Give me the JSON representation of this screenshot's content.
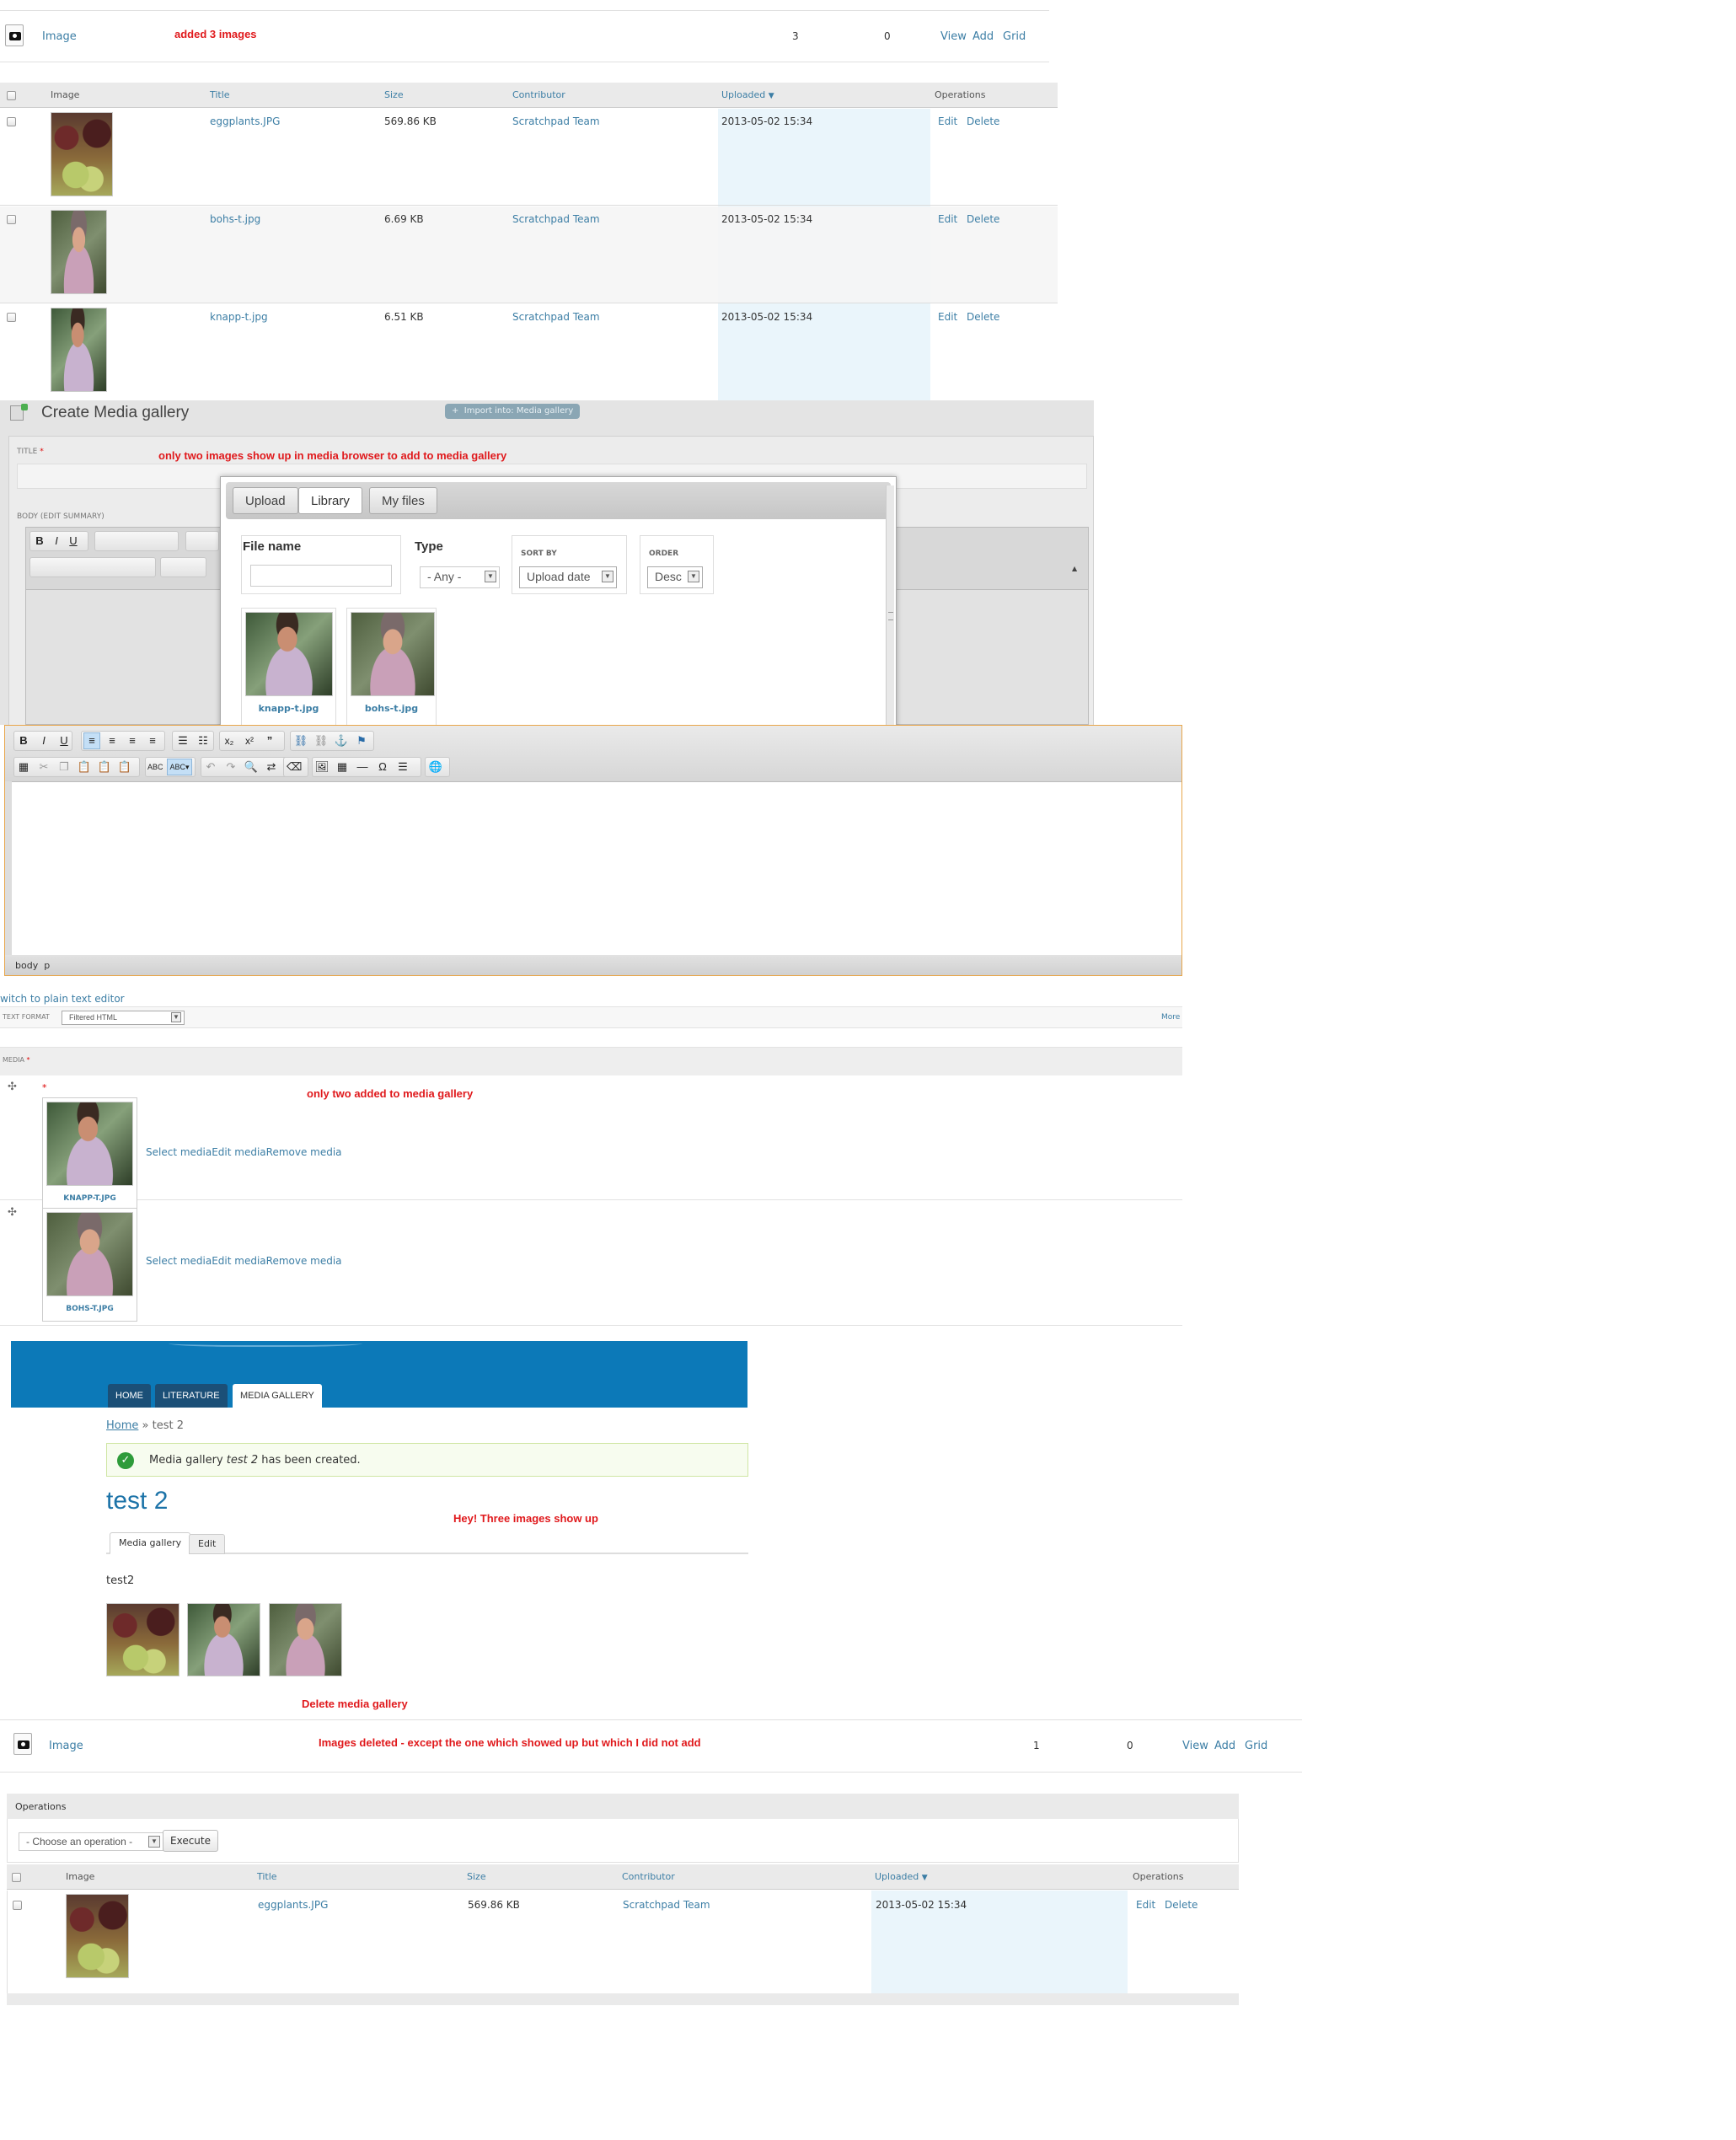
{
  "seg1": {
    "type_label": "Image",
    "annotation": "added 3 images",
    "count": "3",
    "zero": "0",
    "ops": [
      "View",
      "Add",
      "Grid"
    ]
  },
  "table1": {
    "headers": [
      "Image",
      "Title",
      "Size",
      "Contributor",
      "Uploaded",
      "Operations"
    ],
    "rows": [
      {
        "title": "eggplants.JPG",
        "size": "569.86 KB",
        "contributor": "Scratchpad Team",
        "uploaded": "2013-05-02 15:34",
        "edit": "Edit",
        "delete": "Delete"
      },
      {
        "title": "bohs-t.jpg",
        "size": "6.69 KB",
        "contributor": "Scratchpad Team",
        "uploaded": "2013-05-02 15:34",
        "edit": "Edit",
        "delete": "Delete"
      },
      {
        "title": "knapp-t.jpg",
        "size": "6.51 KB",
        "contributor": "Scratchpad Team",
        "uploaded": "2013-05-02 15:34",
        "edit": "Edit",
        "delete": "Delete"
      }
    ]
  },
  "create": {
    "title": "Create Media gallery",
    "import_button": "Import into: Media gallery",
    "title_label": "TITLE",
    "annotation": "only two images show up in media browser to add to media gallery",
    "body_label": "BODY (EDIT SUMMARY)",
    "browser": {
      "tabs": [
        "Upload",
        "Library",
        "My files"
      ],
      "file_name_label": "File name",
      "type_label": "Type",
      "type_value": "- Any -",
      "sort_label": "SORT BY",
      "sort_value": "Upload date",
      "order_label": "ORDER",
      "order_value": "Desc",
      "items": [
        "knapp-t.jpg",
        "bohs-t.jpg"
      ]
    }
  },
  "editor": {
    "path": "body  p",
    "switch_link": "witch to plain text editor",
    "text_format_label": "TEXT FORMAT",
    "text_format_value": "Filtered HTML",
    "more": "More"
  },
  "media_field": {
    "label": "MEDIA",
    "annotation": "only two added to media gallery",
    "items": [
      {
        "caption": "KNAPP-T.JPG",
        "actions": "Select mediaEdit mediaRemove media"
      },
      {
        "caption": "BOHS-T.JPG",
        "actions": "Select mediaEdit mediaRemove media"
      }
    ]
  },
  "site": {
    "nav": [
      "HOME",
      "LITERATURE",
      "MEDIA GALLERY"
    ],
    "breadcrumb_home": "Home",
    "breadcrumb_rest": " » test 2",
    "status_pre": "Media gallery ",
    "status_em": "test 2",
    "status_post": " has been created.",
    "page_title": "test 2",
    "annotation": "Hey! Three images show up",
    "tabs": [
      "Media gallery",
      "Edit"
    ],
    "body": "test2",
    "annotation2": "Delete media gallery"
  },
  "seg_after": {
    "type_label": "Image",
    "annotation": "Images deleted - except the one which showed up but which I did not add",
    "count": "1",
    "zero": "0",
    "ops": [
      "View",
      "Add",
      "Grid"
    ],
    "operations_label": "Operations",
    "operation_select": "- Choose an operation -",
    "execute": "Execute"
  },
  "table2": {
    "headers": [
      "Image",
      "Title",
      "Size",
      "Contributor",
      "Uploaded",
      "Operations"
    ],
    "row": {
      "title": "eggplants.JPG",
      "size": "569.86 KB",
      "contributor": "Scratchpad Team",
      "uploaded": "2013-05-02 15:34",
      "edit": "Edit",
      "delete": "Delete"
    }
  }
}
